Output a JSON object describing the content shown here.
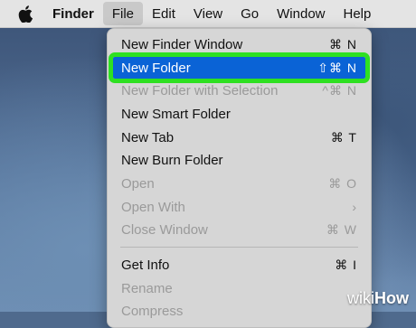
{
  "menubar": {
    "apple_icon": "apple-logo-icon",
    "items": [
      {
        "label": "Finder"
      },
      {
        "label": "File"
      },
      {
        "label": "Edit"
      },
      {
        "label": "View"
      },
      {
        "label": "Go"
      },
      {
        "label": "Window"
      },
      {
        "label": "Help"
      }
    ]
  },
  "file_menu": {
    "items": [
      {
        "label": "New Finder Window",
        "shortcut": "⌘ N",
        "enabled": true
      },
      {
        "label": "New Folder",
        "shortcut": "⇧⌘ N",
        "enabled": true,
        "selected": true
      },
      {
        "label": "New Folder with Selection",
        "shortcut": "^⌘ N",
        "enabled": false
      },
      {
        "label": "New Smart Folder",
        "shortcut": "",
        "enabled": true
      },
      {
        "label": "New Tab",
        "shortcut": "⌘ T",
        "enabled": true
      },
      {
        "label": "New Burn Folder",
        "shortcut": "",
        "enabled": true
      },
      {
        "label": "Open",
        "shortcut": "⌘ O",
        "enabled": false
      },
      {
        "label": "Open With",
        "shortcut": "›",
        "enabled": false
      },
      {
        "label": "Close Window",
        "shortcut": "⌘ W",
        "enabled": false
      },
      {
        "label": "Get Info",
        "shortcut": "⌘ I",
        "enabled": true
      },
      {
        "label": "Rename",
        "shortcut": "",
        "enabled": false
      },
      {
        "label": "Compress",
        "shortcut": "",
        "enabled": false
      }
    ]
  },
  "watermark": {
    "wiki": "wiki",
    "how": "How"
  },
  "colors": {
    "highlight": "#0a63d6",
    "outline": "#2ee021"
  }
}
